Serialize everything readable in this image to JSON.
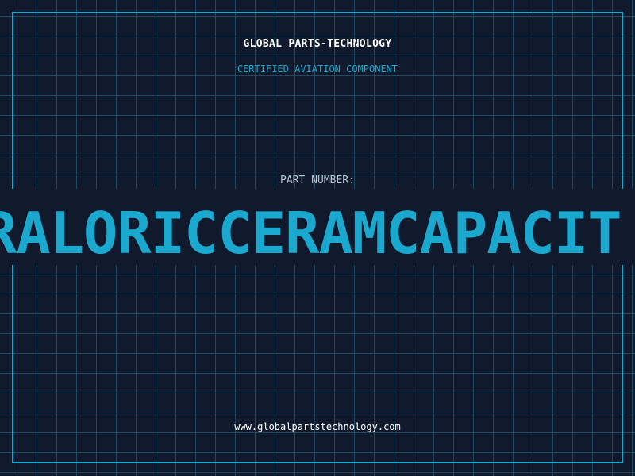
{
  "header": {
    "company": "GLOBAL PARTS-TECHNOLOGY",
    "subtitle": "CERTIFIED AVIATION COMPONENT"
  },
  "part": {
    "label": "PART NUMBER:",
    "value": "RALORICCERAMCAPACIT"
  },
  "footer": {
    "website": "www.globalpartstechnology.com"
  },
  "colors": {
    "background": "#111a2d",
    "grid": "#1d4a5e",
    "accent": "#1ba8cf",
    "text": "#ffffff",
    "label": "#b7c3d2"
  }
}
